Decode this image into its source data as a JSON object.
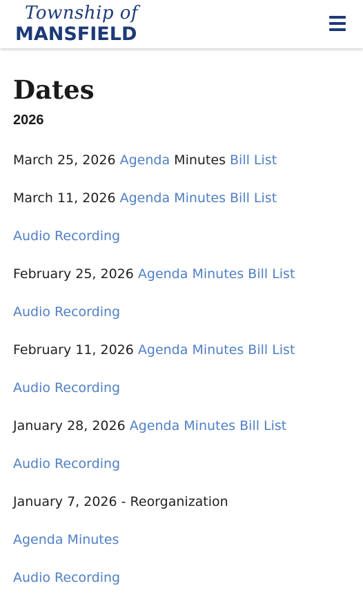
{
  "header": {
    "logo_script": "Township of",
    "logo_main": "MANSFIELD",
    "menu_icon": "hamburger-menu-icon"
  },
  "main": {
    "title": "Dates",
    "year": "2026",
    "rows": [
      {
        "date": "March 25, 2026",
        "agenda": "Agenda",
        "minutes": "Minutes",
        "bill_list": "Bill List"
      },
      {
        "date": "March 11, 2026",
        "agenda": "Agenda",
        "minutes": "Minutes",
        "bill_list": "Bill List"
      },
      {
        "audio": "Audio Recording"
      },
      {
        "date": "February 25, 2026",
        "agenda": "Agenda",
        "minutes": "Minutes",
        "bill_list": "Bill List"
      },
      {
        "audio": "Audio Recording"
      },
      {
        "date": "February 11, 2026",
        "agenda": "Agenda",
        "minutes": "Minutes",
        "bill_list": "Bill List"
      },
      {
        "audio": "Audio Recording"
      },
      {
        "date": "January 28, 2026",
        "agenda": "Agenda",
        "minutes": "Minutes",
        "bill_list": "Bill List"
      },
      {
        "audio": "Audio Recording"
      },
      {
        "date": "January 7, 2026 - Reorganization"
      },
      {
        "agenda": "Agenda",
        "minutes": "Minutes"
      },
      {
        "audio": "Audio Recording"
      }
    ]
  },
  "colors": {
    "brand": "#1d3a78",
    "link": "#4f7fc4",
    "text": "#1f1f1f"
  }
}
